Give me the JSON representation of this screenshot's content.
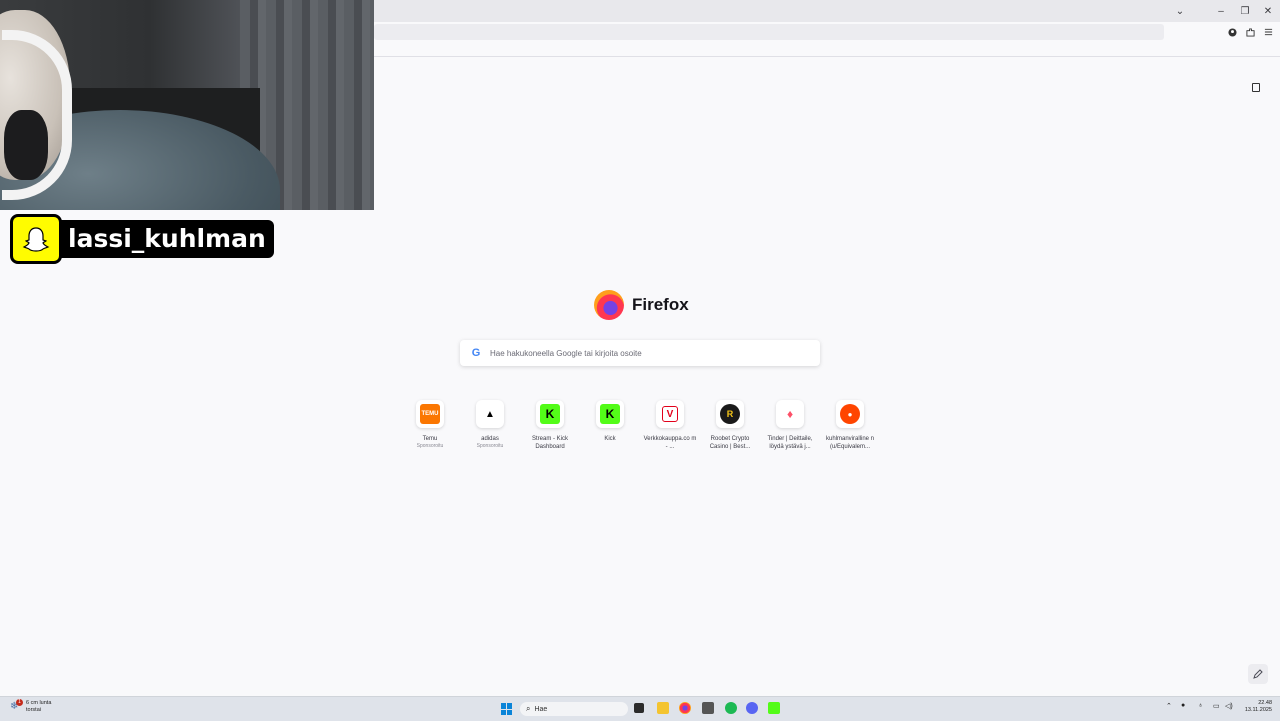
{
  "titlebar": {
    "chevron": "⌄",
    "minimize": "–",
    "restore": "❐",
    "close": "✕"
  },
  "brand": {
    "name": "Firefox"
  },
  "search": {
    "placeholder": "Hae hakukoneella Google tai kirjoita osoite",
    "engine_icon": "G"
  },
  "overlay": {
    "username": "lassi_kuhlman"
  },
  "shortcuts": [
    {
      "title": "Temu",
      "sub": "Sponsoroitu",
      "icon": "temu-icon",
      "color": "#fb7701",
      "glyph": "TEMU"
    },
    {
      "title": "adidas",
      "sub": "Sponsoroitu",
      "icon": "adidas-icon",
      "color": "#ffffff",
      "glyph": "▲"
    },
    {
      "title": "Stream - Kick Dashboard",
      "sub": "",
      "icon": "kick-icon",
      "color": "#53fc18",
      "glyph": "K"
    },
    {
      "title": "Kick",
      "sub": "",
      "icon": "kick-icon",
      "color": "#53fc18",
      "glyph": "K"
    },
    {
      "title": "Verkkokauppa.co m - ...",
      "sub": "",
      "icon": "verkkokauppa-icon",
      "color": "#e2001a",
      "glyph": "V"
    },
    {
      "title": "Roobet Crypto Casino | Best...",
      "sub": "",
      "icon": "roobet-icon",
      "color": "#1a1a1a",
      "glyph": "R"
    },
    {
      "title": "Tinder | Deittaile, löydä ystävä j...",
      "sub": "",
      "icon": "tinder-icon",
      "color": "#fd5068",
      "glyph": "♦"
    },
    {
      "title": "kuhlmanviralline n (u/Equivalem...",
      "sub": "",
      "icon": "reddit-icon",
      "color": "#ff4500",
      "glyph": "●"
    }
  ],
  "taskbar": {
    "weather_line1": "6 cm lunta",
    "weather_line2": "torstai",
    "weather_badge": "1",
    "search_label": "Hae",
    "time": "22.48",
    "date": "13.11.2025"
  }
}
